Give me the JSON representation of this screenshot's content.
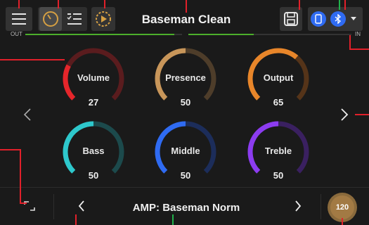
{
  "header": {
    "preset_title": "Baseman Clean",
    "meter_out_label": "OUT",
    "meter_in_label": "IN",
    "meter_out_level": 0.95,
    "meter_in_level": 0.4
  },
  "knobs": [
    {
      "label": "Volume",
      "value": "27",
      "fraction": 0.27,
      "color": "#e5262b",
      "track": "#5a1c1e"
    },
    {
      "label": "Presence",
      "value": "50",
      "fraction": 0.5,
      "color": "#c8965a",
      "track": "#4e3d2a"
    },
    {
      "label": "Output",
      "value": "65",
      "fraction": 0.65,
      "color": "#e8862a",
      "track": "#553419"
    },
    {
      "label": "Bass",
      "value": "50",
      "fraction": 0.5,
      "color": "#2ec8cc",
      "track": "#1c4a4c"
    },
    {
      "label": "Middle",
      "value": "50",
      "fraction": 0.5,
      "color": "#2f6bf2",
      "track": "#1c2d5a"
    },
    {
      "label": "Treble",
      "value": "50",
      "fraction": 0.5,
      "color": "#8c3cf0",
      "track": "#3a2060"
    }
  ],
  "footer": {
    "amp_label": "AMP: Baseman Norm",
    "tempo": "120"
  },
  "icons": {
    "menu": "menu-icon",
    "gauge": "gauge-icon",
    "list": "list-edit-icon",
    "play": "play-circle-icon",
    "save": "save-icon",
    "phone": "phone-icon",
    "bluetooth": "bluetooth-icon",
    "dropdown": "caret-down-icon",
    "prev": "chevron-left-icon",
    "next": "chevron-right-icon",
    "fullscreen": "fullscreen-icon"
  },
  "colors": {
    "accent_blue": "#2f6bf2",
    "meter_green": "#4caf2b",
    "annotation_red": "#e1202a",
    "annotation_green": "#21b14b",
    "tempo_gold": "#a27a44"
  }
}
